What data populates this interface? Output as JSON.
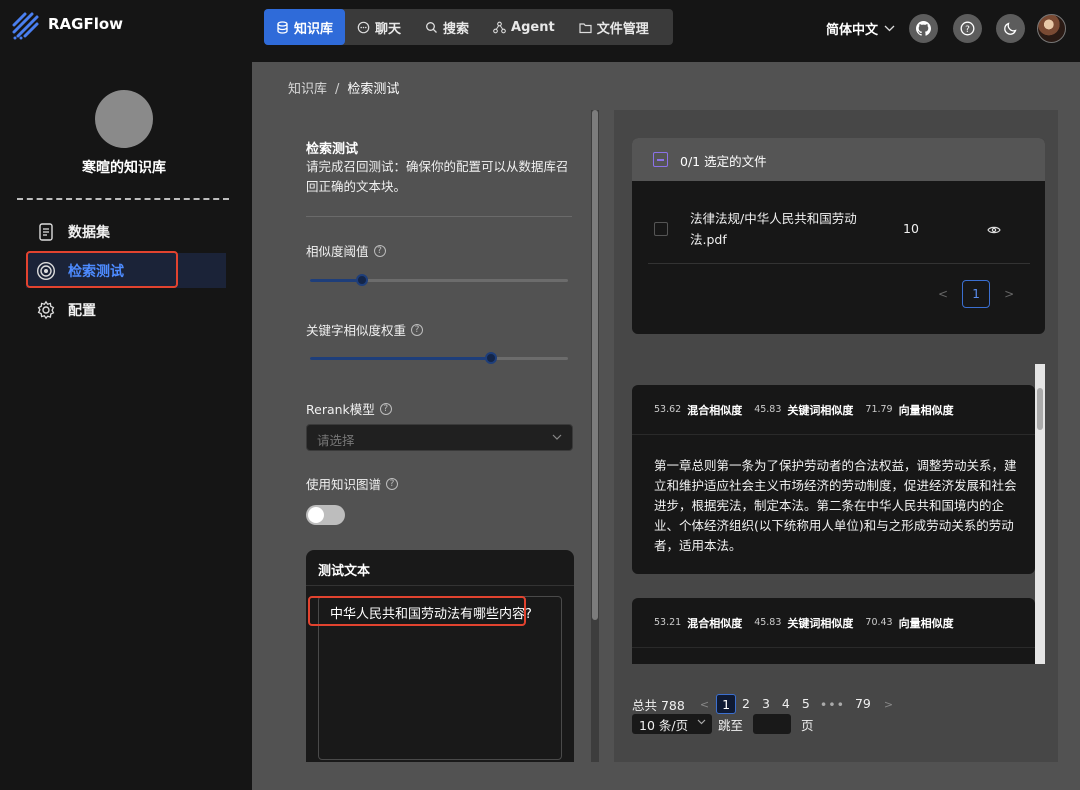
{
  "app": {
    "name": "RAGFlow"
  },
  "nav": {
    "items": [
      {
        "label": "知识库",
        "active": true
      },
      {
        "label": "聊天",
        "active": false
      },
      {
        "label": "搜索",
        "active": false
      },
      {
        "label": "Agent",
        "active": false
      },
      {
        "label": "文件管理",
        "active": false
      }
    ],
    "language": "简体中文"
  },
  "sidebar": {
    "kb_name": "寒暄的知识库",
    "items": [
      {
        "label": "数据集",
        "icon": "document-icon",
        "active": false
      },
      {
        "label": "检索测试",
        "icon": "target-icon",
        "active": true
      },
      {
        "label": "配置",
        "icon": "gear-icon",
        "active": false
      }
    ]
  },
  "breadcrumb": {
    "root": "知识库",
    "separator": "/",
    "current": "检索测试"
  },
  "retrieval": {
    "title": "检索测试",
    "description": "请完成召回测试：确保你的配置可以从数据库召回正确的文本块。",
    "similarity_threshold": {
      "label": "相似度阈值",
      "value": 0.2
    },
    "keyword_weight": {
      "label": "关键字相似度权重",
      "value": 0.7
    },
    "rerank": {
      "label": "Rerank模型",
      "placeholder": "请选择"
    },
    "knowledge_graph": {
      "label": "使用知识图谱",
      "enabled": false
    },
    "test_text": {
      "label": "测试文本",
      "value": "中华人民共和国劳动法有哪些内容?"
    }
  },
  "files": {
    "header": "0/1  选定的文件",
    "rows": [
      {
        "name": "法律法规/中华人民共和国劳动法.pdf",
        "count": "10"
      }
    ],
    "page": "1"
  },
  "chunks": [
    {
      "hybrid_score": "53.62",
      "hybrid_label": "混合相似度",
      "keyword_score": "45.83",
      "keyword_label": "关键词相似度",
      "vector_score": "71.79",
      "vector_label": "向量相似度",
      "text": "第一章总则第一条为了保护劳动者的合法权益，调整劳动关系，建立和维护适应社会主义市场经济的劳动制度，促进经济发展和社会进步，根据宪法，制定本法。第二条在中华人民共和国境内的企业、个体经济组织(以下统称用人单位)和与之形成劳动关系的劳动者，适用本法。"
    },
    {
      "hybrid_score": "53.21",
      "hybrid_label": "混合相似度",
      "keyword_score": "45.83",
      "keyword_label": "关键词相似度",
      "vector_score": "70.43",
      "vector_label": "向量相似度",
      "text": ""
    }
  ],
  "pagination": {
    "total": "总共 788",
    "pages": [
      "1",
      "2",
      "3",
      "4",
      "5"
    ],
    "dots": "•••",
    "last": "79",
    "page_size": "10 条/页",
    "jump_label": "跳至",
    "page_suffix": "页"
  },
  "colors": {
    "accent": "#2f6bd9",
    "highlight_box": "#e2432f",
    "active_text": "#4d8bff"
  }
}
